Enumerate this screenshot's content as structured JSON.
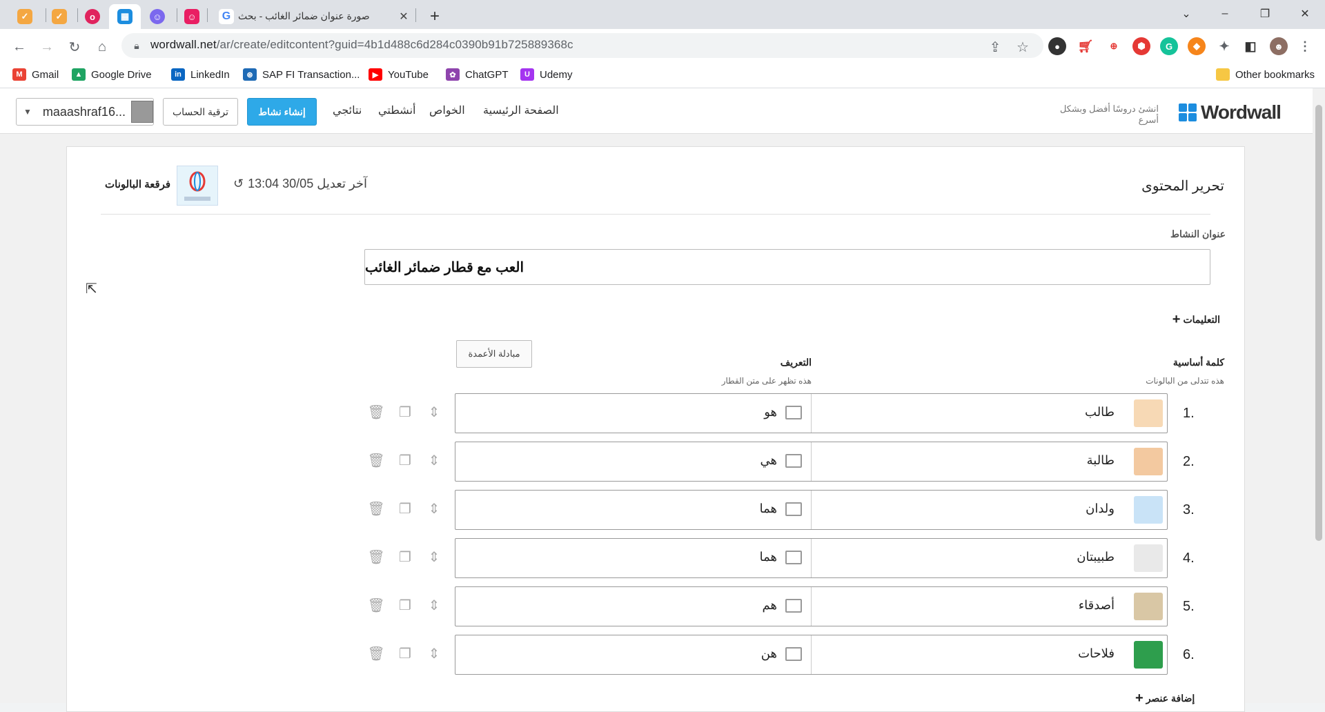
{
  "browser": {
    "tab_title": "صورة عنوان ضمائر الغائب - بحث",
    "url_host": "wordwall.net",
    "url_path": "/ar/create/editcontent?guid=4b1d488c6d284c0390b91b725889368c",
    "bookmarks": [
      {
        "label": "Gmail",
        "icon": "gmail-icon",
        "color": "#ea4335"
      },
      {
        "label": "Google Drive",
        "icon": "drive-icon",
        "color": "#1fa463"
      },
      {
        "label": "LinkedIn",
        "icon": "linkedin-icon",
        "color": "#0a66c2"
      },
      {
        "label": "SAP FI Transaction...",
        "icon": "sap-icon",
        "color": "#1e6ab5"
      },
      {
        "label": "YouTube",
        "icon": "youtube-icon",
        "color": "#ff0000"
      },
      {
        "label": "ChatGPT",
        "icon": "chatgpt-icon",
        "color": "#8e44ad"
      },
      {
        "label": "Udemy",
        "icon": "udemy-icon",
        "color": "#a435f0"
      }
    ],
    "other_bookmarks": "Other bookmarks"
  },
  "header": {
    "logo": "Wordwall",
    "slogan": "انشئ دروسًا أفضل وبشكل أسرع",
    "nav": [
      "الصفحة الرئيسية",
      "الخواص",
      "أنشطتي",
      "نتائجي"
    ],
    "create_btn": "إنشاء نشاط",
    "upgrade_btn": "ترقية الحساب",
    "username": "maaashraf16..."
  },
  "editor": {
    "title": "تحرير المحتوى",
    "last_edit": "آخر تعديل 30/05 13:04",
    "template_name": "فرقعة البالونات",
    "activity_title_label": "عنوان النشاط",
    "activity_title": "العب مع قطار ضمائر الغائب",
    "instructions": "التعليمات",
    "swap_btn": "مبادلة الأعمدة",
    "col_keyword": "كلمة أساسية",
    "col_keyword_sub": "هذه تتدلى من البالونات",
    "col_definition": "التعريف",
    "col_definition_sub": "هذه تظهر على متن القطار",
    "rows": [
      {
        "num": "1.",
        "keyword": "طالب",
        "definition": "هو"
      },
      {
        "num": "2.",
        "keyword": "طالبة",
        "definition": "هي"
      },
      {
        "num": "3.",
        "keyword": "ولدان",
        "definition": "هما"
      },
      {
        "num": "4.",
        "keyword": "طبيبتان",
        "definition": "هما"
      },
      {
        "num": "5.",
        "keyword": "أصدقاء",
        "definition": "هم"
      },
      {
        "num": "6.",
        "keyword": "فلاحات",
        "definition": "هن"
      }
    ],
    "add_item": "إضافة عنصر"
  }
}
